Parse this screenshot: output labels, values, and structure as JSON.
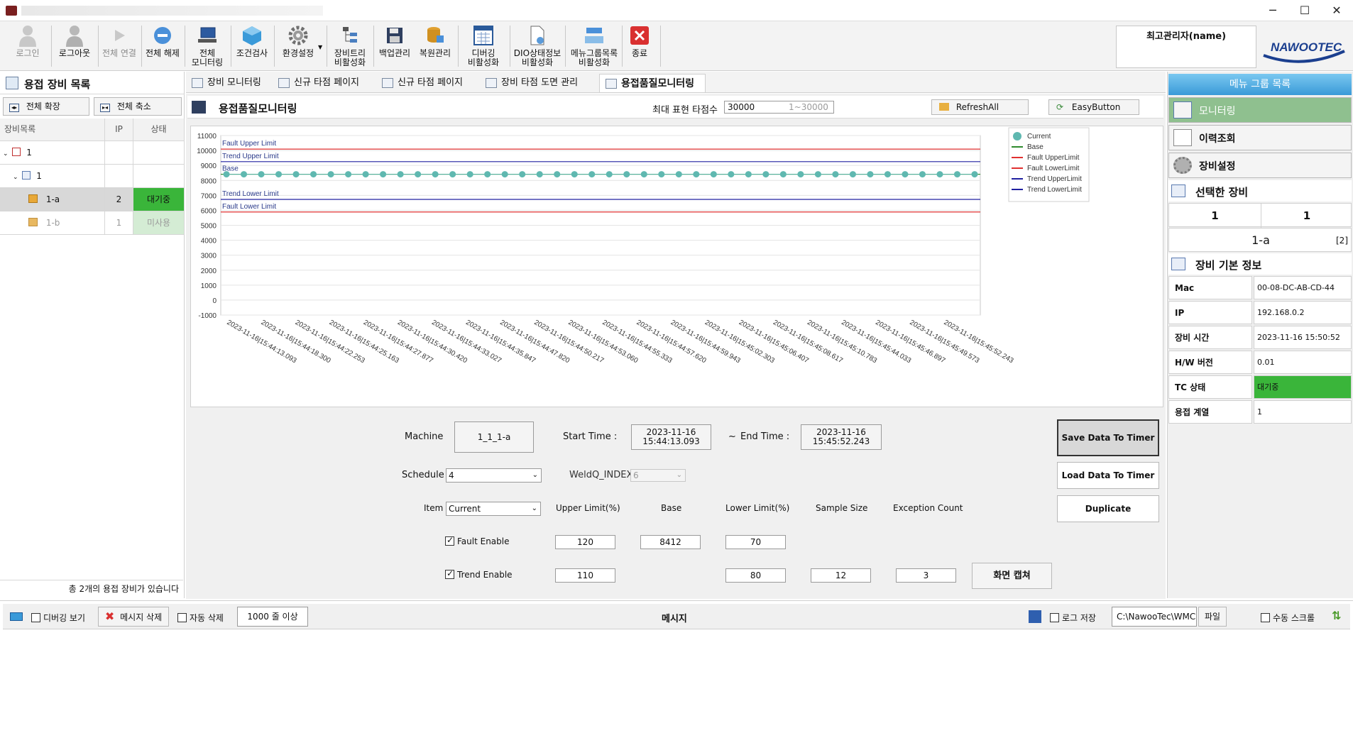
{
  "toolbar": {
    "items": [
      {
        "label": "로그인",
        "icon": "user-icon",
        "disabled": true
      },
      {
        "label": "로그아웃",
        "icon": "user-icon",
        "disabled": false
      },
      {
        "label": "전체 연결",
        "icon": "play-icon",
        "disabled": true
      },
      {
        "label": "전체 해제",
        "icon": "minus-circle-icon",
        "disabled": false
      },
      {
        "label": "전체\n모니터링",
        "icon": "monitor-icon",
        "disabled": false
      },
      {
        "label": "조건검사",
        "icon": "cube-icon",
        "disabled": false
      },
      {
        "label": "환경설정",
        "icon": "gear-icon",
        "disabled": false
      },
      {
        "label": "장비트리\n비활성화",
        "icon": "tree-icon",
        "disabled": false
      },
      {
        "label": "백업관리",
        "icon": "floppy-icon",
        "disabled": false
      },
      {
        "label": "복원관리",
        "icon": "database-icon",
        "disabled": false
      },
      {
        "label": "디버깅\n비활성화",
        "icon": "calendar-icon",
        "disabled": false
      },
      {
        "label": "DIO상태정보\n비활성화",
        "icon": "document-icon",
        "disabled": false
      },
      {
        "label": "메뉴그룹목록\n비활성화",
        "icon": "window-icon",
        "disabled": false
      },
      {
        "label": "종료",
        "icon": "close-icon",
        "disabled": false
      }
    ],
    "admin_name": "최고관리자(name)",
    "logo_text": "NAWOOTEC"
  },
  "left_panel": {
    "title": "용접 장비 목록",
    "expand_all": "전체 확장",
    "collapse_all": "전체 축소",
    "col_device": "장비목록",
    "col_ip": "IP",
    "col_status": "상태",
    "rows": [
      {
        "name": "1",
        "ip": "",
        "status": ""
      },
      {
        "name": "1",
        "ip": "",
        "status": ""
      },
      {
        "name": "1-a",
        "ip": "2",
        "status": "대기중"
      },
      {
        "name": "1-b",
        "ip": "1",
        "status": "미사용"
      }
    ],
    "footer": "총 2개의 용접 장비가 있습니다"
  },
  "tabs": [
    {
      "label": "장비 모니터링"
    },
    {
      "label": "신규 타점 페이지"
    },
    {
      "label": "신규 타점 페이지"
    },
    {
      "label": "장비 타점 도면 관리"
    },
    {
      "label": "용접품질모니터링"
    }
  ],
  "monitor": {
    "title": "용접품질모니터링",
    "max_points_label": "최대 표현 타점수",
    "max_points_value": "30000",
    "max_points_range": "1~30000",
    "refresh_all": "RefreshAll",
    "easy_button": "EasyButton"
  },
  "chart_data": {
    "type": "line",
    "ylim": [
      -1000,
      11000
    ],
    "yticks": [
      "11000",
      "10000",
      "9000",
      "8000",
      "7000",
      "6000",
      "5000",
      "4000",
      "3000",
      "2000",
      "1000",
      "0",
      "-1000"
    ],
    "x": [
      "2023-11-16|15:44:13.093",
      "2023-11-16|15:44:18.300",
      "2023-11-16|15:44:22.253",
      "2023-11-16|15:44:25.163",
      "2023-11-16|15:44:27.877",
      "2023-11-16|15:44:30.420",
      "2023-11-16|15:44:33.027",
      "2023-11-16|15:44:35.847",
      "2023-11-16|15:44:47.820",
      "2023-11-16|15:44:50.217",
      "2023-11-16|15:44:53.060",
      "2023-11-16|15:44:55.333",
      "2023-11-16|15:44:57.620",
      "2023-11-16|15:44:59.943",
      "2023-11-16|15:45:02.303",
      "2023-11-16|15:45:06.407",
      "2023-11-16|15:45:08.617",
      "2023-11-16|15:45:10.783",
      "2023-11-16|15:45:44.033",
      "2023-11-16|15:45:46.897",
      "2023-11-16|15:45:49.573",
      "2023-11-16|15:45:52.243"
    ],
    "series": [
      {
        "name": "Current",
        "color": "#5fb8b0",
        "values": [
          8412,
          8412,
          8412,
          8412,
          8412,
          8412,
          8412,
          8412,
          8412,
          8412,
          8412,
          8412,
          8412,
          8412,
          8412,
          8412,
          8412,
          8412,
          8412,
          8412,
          8412,
          8412,
          8412,
          8412,
          8412,
          8412,
          8412,
          8412,
          8412,
          8412,
          8412,
          8412,
          8412,
          8412,
          8412,
          8412,
          8412,
          8412,
          8412,
          8412,
          8412,
          8412,
          8412,
          8412
        ]
      },
      {
        "name": "Base",
        "color": "#2e8b2e",
        "value": 8412
      },
      {
        "name": "Fault UpperLimit",
        "color": "#e03030",
        "value": 10094
      },
      {
        "name": "Fault LowerLimit",
        "color": "#e03030",
        "value": 5888
      },
      {
        "name": "Trend UpperLimit",
        "color": "#2020a0",
        "value": 9253
      },
      {
        "name": "Trend LowerLimit",
        "color": "#2020a0",
        "value": 6730
      }
    ],
    "annotations": [
      "Fault Upper Limit",
      "Trend Upper Limit",
      "Base",
      "Trend Lower Limit",
      "Fault Lower Limit"
    ],
    "grid": true,
    "legend": "top-right"
  },
  "form": {
    "machine_label": "Machine",
    "machine_value": "1_1_1-a",
    "start_label": "Start Time :",
    "start_value": "2023-11-16\n15:44:13.093",
    "tilde": "~",
    "end_label": "End Time :",
    "end_value": "2023-11-16\n15:45:52.243",
    "schedule_label": "Schedule",
    "schedule_value": "4",
    "weldq_label": "WeldQ_INDEX",
    "weldq_value": "6",
    "item_label": "Item",
    "item_value": "Current",
    "upper_label": "Upper Limit(%)",
    "base_label": "Base",
    "lower_label": "Lower Limit(%)",
    "sample_label": "Sample Size",
    "exception_label": "Exception Count",
    "fault_enable": "Fault Enable",
    "fault_upper": "120",
    "fault_base": "8412",
    "fault_lower": "70",
    "trend_enable": "Trend Enable",
    "trend_upper": "110",
    "trend_lower": "80",
    "trend_sample": "12",
    "trend_exception": "3",
    "capture": "화면 캡쳐",
    "save_timer": "Save Data To Timer",
    "load_timer": "Load Data To Timer",
    "duplicate": "Duplicate"
  },
  "right_panel": {
    "title": "메뉴 그룹 목록",
    "menu": [
      "모니터링",
      "이력조회",
      "장비설정"
    ],
    "selected_title": "선택한 장비",
    "sel_a": "1",
    "sel_b": "1",
    "sel_name": "1-a",
    "sel_count": "[2]",
    "info_title": "장비 기본 정보",
    "info": [
      {
        "k": "Mac",
        "v": "00-08-DC-AB-CD-44"
      },
      {
        "k": "IP",
        "v": "192.168.0.2"
      },
      {
        "k": "장비 시간",
        "v": "2023-11-16   15:50:52"
      },
      {
        "k": "H/W 버전",
        "v": "0.01"
      },
      {
        "k": "TC 상태",
        "v": "대기중"
      },
      {
        "k": "용접 계열",
        "v": "1"
      }
    ]
  },
  "bottom": {
    "debug_view": "디버깅 보기",
    "delete_msg": "메시지 삭제",
    "auto_delete": "자동 삭제",
    "lines": "1000 줄 이상",
    "message": "메시지",
    "log_save": "로그 저장",
    "path": "C:\\NawooTec\\WMCS\\L",
    "file": "파일",
    "manual_scroll": "수동 스크롤"
  }
}
